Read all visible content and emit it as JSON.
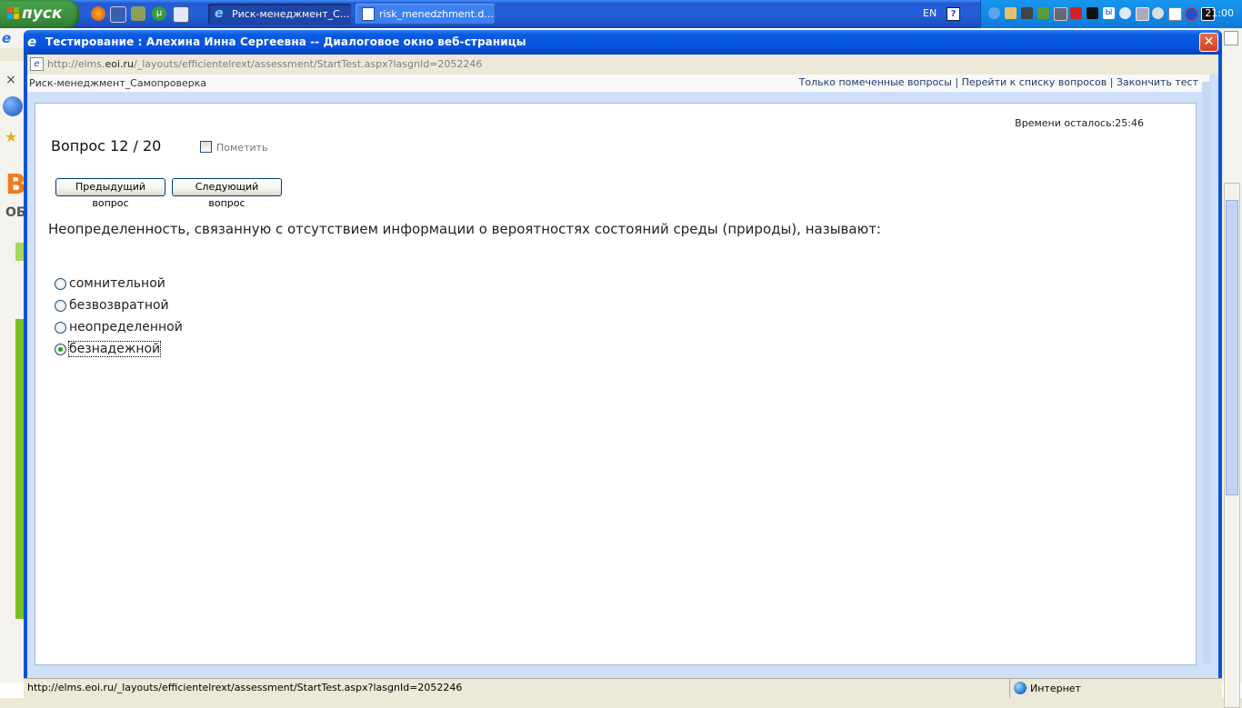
{
  "taskbar": {
    "start_label": "пуск",
    "tasks": [
      {
        "label": "Риск-менеджмент_С...",
        "active": true
      },
      {
        "label": "risk_menedzhment.d...",
        "active": false
      }
    ],
    "lang": "EN",
    "help": "?",
    "clock": "21:00"
  },
  "dialog": {
    "title": "Тестирование : Алехина Инна Сергеевна -- Диалоговое окно веб-страницы",
    "close_glyph": "✕",
    "address_prefix": "http://elms.",
    "address_domain": "eoi.ru",
    "address_suffix": "/_layouts/efficientelrext/assessment/StartTest.aspx?lasgnId=2052246"
  },
  "header": {
    "course": "Риск-менеджмент_Самопроверка",
    "links": [
      "Только помеченные вопросы",
      "Перейти к списку вопросов",
      "Закончить тест"
    ],
    "separator": "|"
  },
  "test": {
    "time_left": "Времени осталось:25:46",
    "question_number": "Вопрос 12 / 20",
    "mark_label": "Пометить",
    "prev_label": "Предыдущий вопрос",
    "next_label": "Следующий вопрос",
    "question_text": "Неопределенность, связанную с отсутствием информации о вероятностях состояний среды (природы), называют:",
    "options": [
      {
        "label": "сомнительной",
        "selected": false
      },
      {
        "label": "безвозвратной",
        "selected": false
      },
      {
        "label": "неопределенной",
        "selected": false
      },
      {
        "label": "безнадежной",
        "selected": true
      }
    ]
  },
  "status": {
    "url": "http://elms.eoi.ru/_layouts/efficientelrext/assessment/StartTest.aspx?lasgnId=2052246",
    "zone": "Интернет"
  },
  "colors": {
    "titlebar": "#0654dd",
    "accent_green": "#7bbf24",
    "selected_radio": "#21a121"
  }
}
